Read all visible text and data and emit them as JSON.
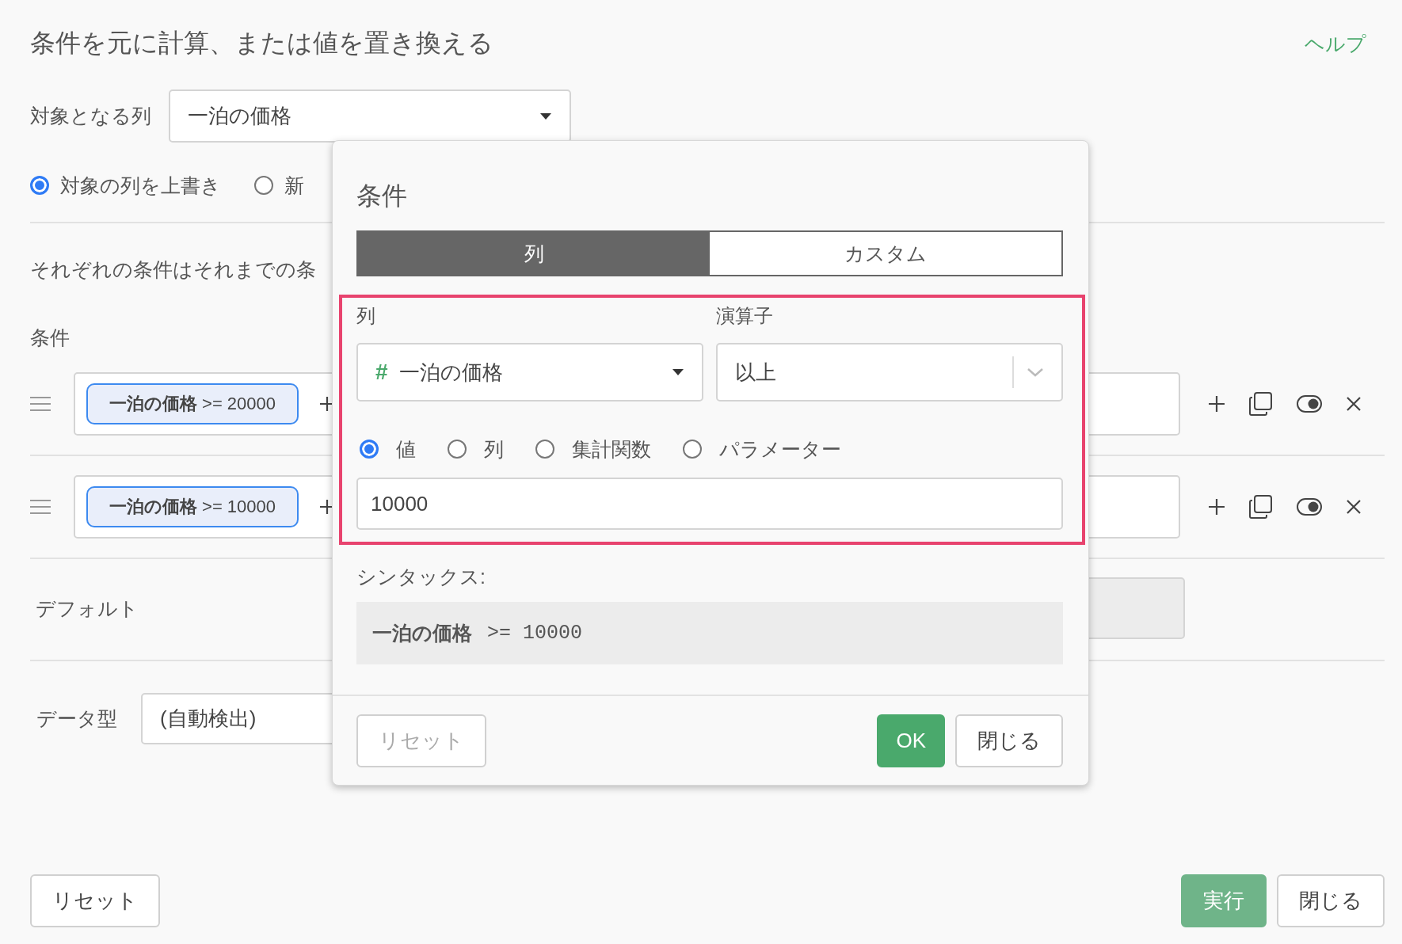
{
  "title": "条件を元に計算、または値を置き換える",
  "help_link": "ヘルプ",
  "target_column": {
    "label": "対象となる列",
    "value": "一泊の価格"
  },
  "output_options": [
    {
      "label": "対象の列を上書き",
      "selected": true
    },
    {
      "label": "新",
      "selected": false
    }
  ],
  "description": "それぞれの条件はそれまでの条",
  "conditions": {
    "label": "条件",
    "rows": [
      {
        "chip": "**一泊の価格** >= 20000",
        "enabled": true
      },
      {
        "chip": "**一泊の価格** >= 10000",
        "enabled": true
      }
    ]
  },
  "default": {
    "label": "デフォルト",
    "disabled": true
  },
  "data_type": {
    "label": "データ型",
    "value": "(自動検出)"
  },
  "footer": {
    "reset": "リセット",
    "run": {
      "label": "実行",
      "disabled": true
    },
    "close": "閉じる"
  },
  "dialog": {
    "title": "条件",
    "tabs": [
      {
        "label": "列",
        "selected": true
      },
      {
        "label": "カスタム",
        "selected": false
      }
    ],
    "column_label": "列",
    "operator_label": "演算子",
    "column_select": {
      "icon": "#",
      "value": "一泊の価格"
    },
    "operator_select": {
      "value": "以上"
    },
    "value_kinds": [
      {
        "label": "値",
        "selected": true
      },
      {
        "label": "列",
        "selected": false
      },
      {
        "label": "集計関数",
        "selected": false
      },
      {
        "label": "パラメーター",
        "selected": false
      }
    ],
    "value": "10000",
    "syntax_label": "シンタックス:",
    "syntax": "**一泊の価格** >= 10000",
    "buttons": {
      "reset": {
        "label": "リセット",
        "disabled": true
      },
      "ok": "OK",
      "close": "閉じる"
    }
  }
}
